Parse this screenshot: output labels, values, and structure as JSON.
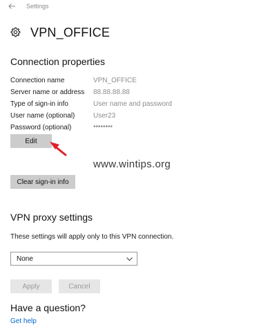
{
  "app": {
    "title": "Settings"
  },
  "page": {
    "title": "VPN_OFFICE"
  },
  "connection": {
    "section_title": "Connection properties",
    "props": [
      {
        "label": "Connection name",
        "value": "VPN_OFFICE"
      },
      {
        "label": "Server name or address",
        "value": "88.88.88.88"
      },
      {
        "label": "Type of sign-in info",
        "value": "User name and password"
      },
      {
        "label": "User name (optional)",
        "value": "User23"
      },
      {
        "label": "Password (optional)",
        "value": "••••••••"
      }
    ],
    "edit_label": "Edit",
    "clear_label": "Clear sign-in info"
  },
  "watermark": "www.wintips.org",
  "proxy": {
    "section_title": "VPN proxy settings",
    "description": "These settings will apply only to this VPN connection.",
    "selected": "None",
    "apply_label": "Apply",
    "cancel_label": "Cancel"
  },
  "help": {
    "section_title": "Have a question?",
    "link_label": "Get help"
  },
  "colors": {
    "link": "#0066cc",
    "arrow": "#e0202a",
    "button": "#cccccc"
  }
}
